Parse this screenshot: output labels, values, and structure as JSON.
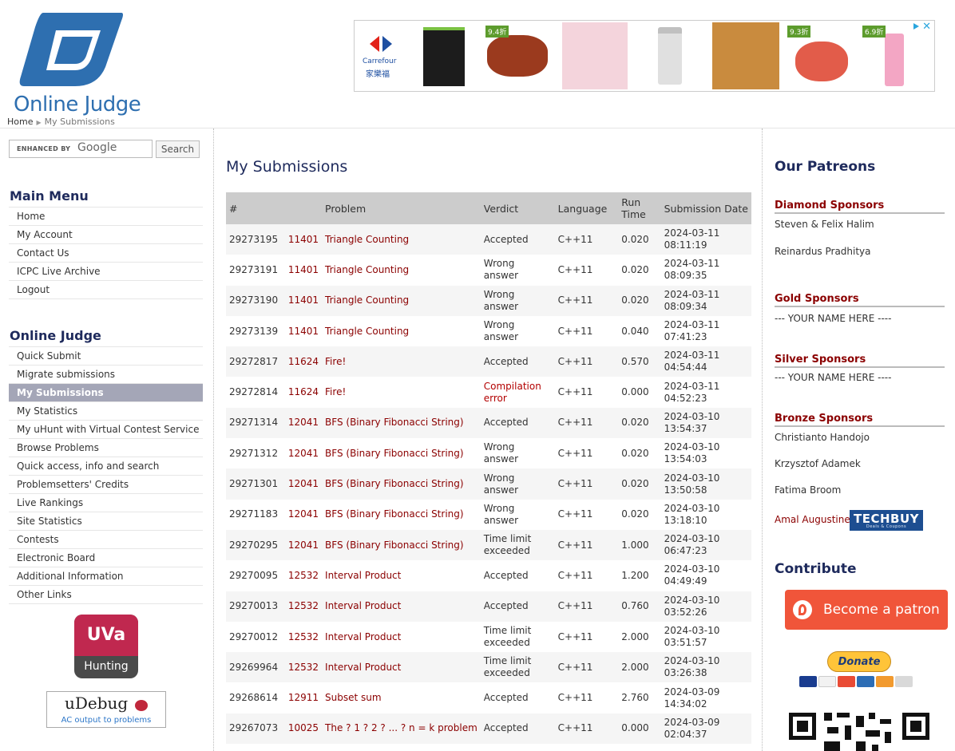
{
  "site": {
    "logo_text": "Online Judge"
  },
  "breadcrumb": {
    "home": "Home",
    "current": "My Submissions"
  },
  "ad": {
    "brand_en": "Carrefour",
    "brand_zh": "家樂福",
    "badges": [
      "9.4折",
      "9.3折",
      "6.9折"
    ]
  },
  "search": {
    "enhanced": "ENHANCED BY",
    "google": "Google",
    "button": "Search"
  },
  "main_menu": {
    "title": "Main Menu",
    "items": [
      "Home",
      "My Account",
      "Contact Us",
      "ICPC Live Archive",
      "Logout"
    ]
  },
  "oj_menu": {
    "title": "Online Judge",
    "items": [
      "Quick Submit",
      "Migrate submissions",
      "My Submissions",
      "My Statistics",
      "My uHunt with Virtual Contest Service",
      "Browse Problems",
      "Quick access, info and search",
      "Problemsetters' Credits",
      "Live Rankings",
      "Site Statistics",
      "Contests",
      "Electronic Board",
      "Additional Information",
      "Other Links"
    ],
    "active": "My Submissions"
  },
  "uva": {
    "top": "UVa",
    "bottom": "Hunting"
  },
  "udebug": {
    "name": "uDebug",
    "tagline": "AC output to problems"
  },
  "page": {
    "title": "My Submissions"
  },
  "table": {
    "headers": [
      "#",
      "Problem",
      "Verdict",
      "Language",
      "Run Time",
      "Submission Date"
    ],
    "rows": [
      {
        "id": "29273195",
        "num": "11401",
        "title": "Triangle Counting",
        "verdict": "Accepted",
        "lang": "C++11",
        "time": "0.020",
        "date": "2024-03-11",
        "clock": "08:11:19"
      },
      {
        "id": "29273191",
        "num": "11401",
        "title": "Triangle Counting",
        "verdict": "Wrong answer",
        "lang": "C++11",
        "time": "0.020",
        "date": "2024-03-11",
        "clock": "08:09:35"
      },
      {
        "id": "29273190",
        "num": "11401",
        "title": "Triangle Counting",
        "verdict": "Wrong answer",
        "lang": "C++11",
        "time": "0.020",
        "date": "2024-03-11",
        "clock": "08:09:34"
      },
      {
        "id": "29273139",
        "num": "11401",
        "title": "Triangle Counting",
        "verdict": "Wrong answer",
        "lang": "C++11",
        "time": "0.040",
        "date": "2024-03-11",
        "clock": "07:41:23"
      },
      {
        "id": "29272817",
        "num": "11624",
        "title": "Fire!",
        "verdict": "Accepted",
        "lang": "C++11",
        "time": "0.570",
        "date": "2024-03-11",
        "clock": "04:54:44"
      },
      {
        "id": "29272814",
        "num": "11624",
        "title": "Fire!",
        "verdict": "Compilation error",
        "lang": "C++11",
        "time": "0.000",
        "date": "2024-03-11",
        "clock": "04:52:23"
      },
      {
        "id": "29271314",
        "num": "12041",
        "title": "BFS (Binary Fibonacci String)",
        "verdict": "Accepted",
        "lang": "C++11",
        "time": "0.020",
        "date": "2024-03-10",
        "clock": "13:54:37"
      },
      {
        "id": "29271312",
        "num": "12041",
        "title": "BFS (Binary Fibonacci String)",
        "verdict": "Wrong answer",
        "lang": "C++11",
        "time": "0.020",
        "date": "2024-03-10",
        "clock": "13:54:03"
      },
      {
        "id": "29271301",
        "num": "12041",
        "title": "BFS (Binary Fibonacci String)",
        "verdict": "Wrong answer",
        "lang": "C++11",
        "time": "0.020",
        "date": "2024-03-10",
        "clock": "13:50:58"
      },
      {
        "id": "29271183",
        "num": "12041",
        "title": "BFS (Binary Fibonacci String)",
        "verdict": "Wrong answer",
        "lang": "C++11",
        "time": "0.020",
        "date": "2024-03-10",
        "clock": "13:18:10"
      },
      {
        "id": "29270295",
        "num": "12041",
        "title": "BFS (Binary Fibonacci String)",
        "verdict": "Time limit exceeded",
        "lang": "C++11",
        "time": "1.000",
        "date": "2024-03-10",
        "clock": "06:47:23"
      },
      {
        "id": "29270095",
        "num": "12532",
        "title": "Interval Product",
        "verdict": "Accepted",
        "lang": "C++11",
        "time": "1.200",
        "date": "2024-03-10",
        "clock": "04:49:49"
      },
      {
        "id": "29270013",
        "num": "12532",
        "title": "Interval Product",
        "verdict": "Accepted",
        "lang": "C++11",
        "time": "0.760",
        "date": "2024-03-10",
        "clock": "03:52:26"
      },
      {
        "id": "29270012",
        "num": "12532",
        "title": "Interval Product",
        "verdict": "Time limit exceeded",
        "lang": "C++11",
        "time": "2.000",
        "date": "2024-03-10",
        "clock": "03:51:57"
      },
      {
        "id": "29269964",
        "num": "12532",
        "title": "Interval Product",
        "verdict": "Time limit exceeded",
        "lang": "C++11",
        "time": "2.000",
        "date": "2024-03-10",
        "clock": "03:26:38"
      },
      {
        "id": "29268614",
        "num": "12911",
        "title": "Subset sum",
        "verdict": "Accepted",
        "lang": "C++11",
        "time": "2.760",
        "date": "2024-03-09",
        "clock": "14:34:02"
      },
      {
        "id": "29267073",
        "num": "10025",
        "title": "The ? 1 ? 2 ? ... ? n = k problem",
        "verdict": "Accepted",
        "lang": "C++11",
        "time": "0.000",
        "date": "2024-03-09",
        "clock": "02:04:37"
      }
    ]
  },
  "patreons": {
    "title": "Our Patreons",
    "diamond": {
      "head": "Diamond Sponsors",
      "names": [
        "Steven & Felix Halim",
        "Reinardus Pradhitya"
      ]
    },
    "gold": {
      "head": "Gold Sponsors",
      "names": [
        "--- YOUR NAME HERE ----"
      ]
    },
    "silver": {
      "head": "Silver Sponsors",
      "names": [
        "--- YOUR NAME HERE ----"
      ]
    },
    "bronze": {
      "head": "Bronze Sponsors",
      "names": [
        "Christianto Handojo",
        "Krzysztof Adamek",
        "Fatima Broom",
        "Amal Augustine"
      ]
    },
    "techbuy": "TECHBUY",
    "techbuy_sub": "Deals & Coupons"
  },
  "contribute": {
    "title": "Contribute",
    "patron_button": "Become a patron",
    "donate_button": "Donate"
  },
  "colors": {
    "heading": "#1e2a5c",
    "link_red": "#8b0000",
    "logo_blue": "#2e6fb0",
    "menu_active": "#a4a6b7",
    "patron_orange": "#f0553a"
  }
}
